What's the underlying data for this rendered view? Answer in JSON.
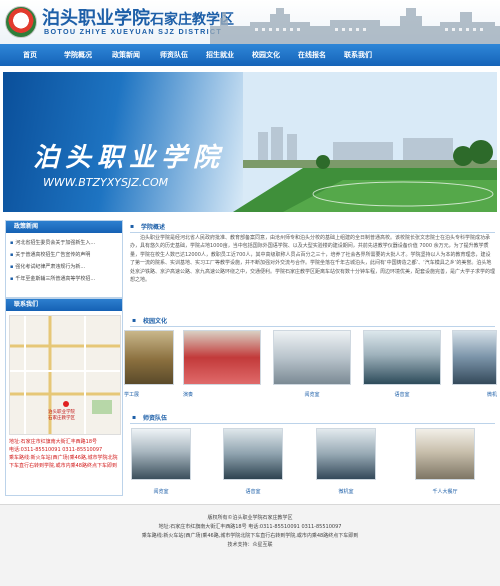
{
  "header": {
    "logo_title": "泊头职业学院",
    "logo_subtitle": "石家庄教学区",
    "logo_english": "BOTOU ZHIYE XUEYUAN SJZ DISTRICT"
  },
  "nav": {
    "items": [
      "首页",
      "学院概况",
      "政策新闻",
      "师资队伍",
      "招生就业",
      "校园文化",
      "在线报名",
      "联系我们"
    ]
  },
  "banner": {
    "title": "泊头职业学院",
    "url": "WWW.BTZYXYSJZ.COM"
  },
  "news": {
    "heading": "政策新闻",
    "items": [
      "河北省招生委员会关于加强新生入...",
      "关于普通高校招生广告宣传的声明",
      "强化考试纪律严肃违规行为新...",
      "千年至金斯辅三所普通高等学校招..."
    ]
  },
  "contact": {
    "heading": "联系我们",
    "map_label": "泊头职业学院\n石家庄教学区",
    "address": "地址:石家庄市红旗南大街汇丰西路18号",
    "phone": "电话:0311-85510091 0311-85510097",
    "route": "乘车路线:新火车站(西广场)乘46路,城市学院北院下车直行右转到学院,或市内乘48路终点下车即到"
  },
  "intro": {
    "heading": "学院概述",
    "text": "泊头职业学院是经河北省人民政府批准、教育部备案同意，由沧州师专和泊头分校的基础上组建的全日制普通高校。该校院长张文忠院士在泊头专科学院成功承办，具有悠久的历史基础，学院占地1000亩，当中包括国际外国语学院、以及大型实验楼的建设期间，共前先进教学仪器设备价值 7000 余万元，为了提升教学质量，学院在校生人数已达12000人，教职员工近700人，其中高级职称人员占百分之三十，培养了社会各界所需要的大批人才。学院坚持以人为本的教育理念，建设了第一流的院系、实训基地、实习工厂等教学设施，并不断加强对外交流与合作。学院坐落在千年古城泊头，此间有‘中国铸造之都’、‘汽车模具之乡’的美誉。泊头地处京沪铁路、京沪高速公路、京九高速公路环绕之中，交通便利。学院石家庄教学区距离车站仅有数十分钟车程，周边环境优美，配套设施完善，是广大学子求学的理想之地。"
  },
  "culture": {
    "heading": "校园文化",
    "captions": [
      "学工展",
      "演奏",
      "阅览室",
      "语音室",
      "微机"
    ]
  },
  "teachers": {
    "heading": "师资队伍",
    "captions": [
      "阅览室",
      "语音室",
      "微机室",
      "千人大餐厅"
    ]
  },
  "footer": {
    "line1": "版权所有©泊头职业学院石家庄教学区",
    "line2": "地址:石家庄市红旗南大街汇丰西路18号 电话:0311-85510091 0311-85510097",
    "line3": "乘车路线:新火车站(西广场)乘46路,城市学院北院下车直行右转到学院,或市内乘48路终点下车即到",
    "line4": "技术支持：众星互联"
  },
  "colors": {
    "brand_blue": "#1d5fa8",
    "nav_blue": "#1563b8",
    "contact_red": "#d21b1b"
  }
}
